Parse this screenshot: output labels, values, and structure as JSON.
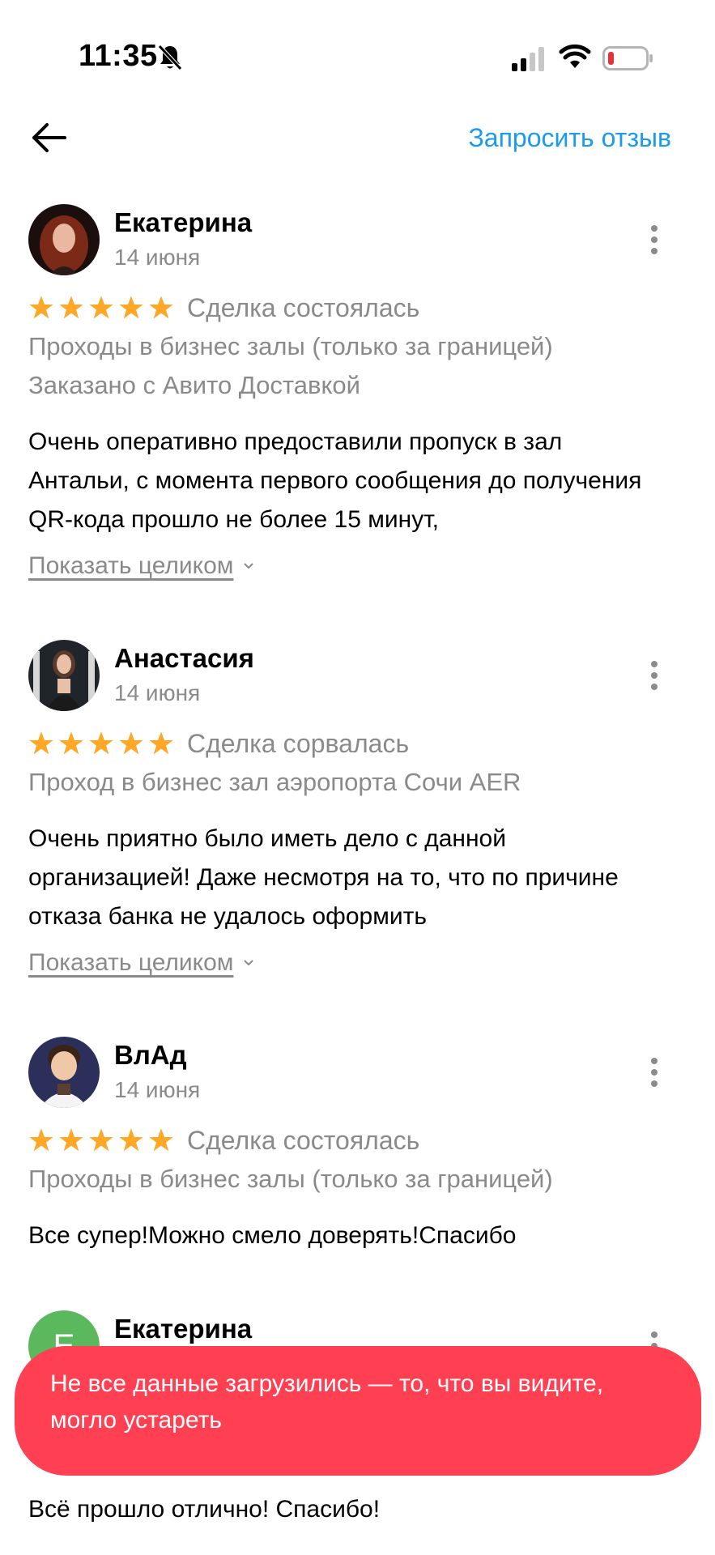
{
  "status_bar": {
    "time": "11:35",
    "icons": [
      "bell-off-icon",
      "signal-icon",
      "wifi-icon",
      "battery-low-icon"
    ],
    "battery_color": "#e5333c"
  },
  "header": {
    "back_icon": "arrow-left-icon",
    "request_review_label": "Запросить отзыв",
    "accent_color": "#1a9bf0"
  },
  "reviews": [
    {
      "author": "Екатерина",
      "date": "14 июня",
      "rating": 5,
      "deal_status": "Сделка состоялась",
      "item": "Проходы в бизнес залы (только за границей)",
      "delivery": "Заказано с Авито Доставкой",
      "text": "Очень оперативно предоставили пропуск в зал Антальи, с момента первого сообщения до получения QR-кода прошло не более 15 минут,",
      "show_more": "Показать целиком"
    },
    {
      "author": "Анастасия",
      "date": "14 июня",
      "rating": 5,
      "deal_status": "Сделка сорвалась",
      "item": "Проход в бизнес зал аэропорта Сочи AER",
      "text": "Очень приятно было иметь дело с данной организацией! Даже несмотря на то, что по причине отказа банка не удалось оформить",
      "show_more": "Показать целиком"
    },
    {
      "author": "ВлАд",
      "date": "14 июня",
      "rating": 5,
      "deal_status": "Сделка состоялась",
      "item": "Проходы в бизнес залы (только за границей)",
      "text": "Все супер!Можно смело доверять!Спасибо"
    },
    {
      "author": "Екатерина",
      "avatar_letter": "Е",
      "avatar_color": "#5cb85c",
      "text": "Всё прошло отлично! Спасибо!"
    }
  ],
  "toast": {
    "message": "Не все данные загрузились — то, что вы видите, могло устареть",
    "color": "#ff4053"
  },
  "star_color": "#ffa726"
}
